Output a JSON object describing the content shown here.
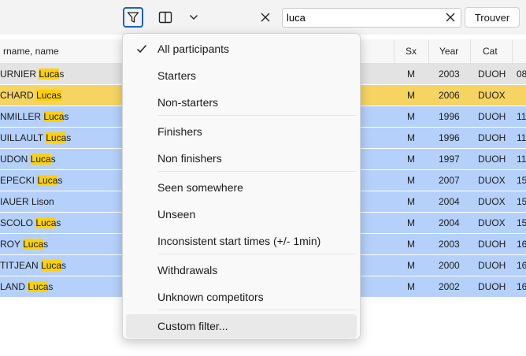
{
  "toolbar": {
    "search_value": "luca",
    "find_label": "Trouver"
  },
  "grid": {
    "columns": {
      "name": "rname, name",
      "sx": "Sx",
      "year": "Year",
      "cat": "Cat"
    },
    "rows": [
      {
        "pre": "URNIER ",
        "hl": "Luca",
        "post": "s",
        "sx": "M",
        "year": "2003",
        "cat": "DUOH",
        "extra": "08",
        "bg": "#e3e3e3"
      },
      {
        "pre": "CHARD ",
        "hl": "Lucas",
        "post": "",
        "sx": "M",
        "year": "2006",
        "cat": "DUOX",
        "extra": "",
        "bg": "#f6d462"
      },
      {
        "pre": "NMILLER ",
        "hl": "Luca",
        "post": "s",
        "sx": "M",
        "year": "1996",
        "cat": "DUOH",
        "extra": "11",
        "bg": "#b5d1fb"
      },
      {
        "pre": "UILLAULT ",
        "hl": "Luca",
        "post": "s",
        "sx": "M",
        "year": "1996",
        "cat": "DUOH",
        "extra": "11",
        "bg": "#b5d1fb"
      },
      {
        "pre": "UDON ",
        "hl": "Luca",
        "post": "s",
        "sx": "M",
        "year": "1997",
        "cat": "DUOH",
        "extra": "11",
        "bg": "#b5d1fb"
      },
      {
        "pre": "EPECKI ",
        "hl": "Luca",
        "post": "s",
        "sx": "M",
        "year": "2007",
        "cat": "DUOX",
        "extra": "15",
        "bg": "#b5d1fb"
      },
      {
        "pre": "IAUER Lison",
        "hl": "",
        "post": "",
        "sx": "M",
        "year": "2004",
        "cat": "DUOX",
        "extra": "15",
        "bg": "#b5d1fb"
      },
      {
        "pre": "SCOLO ",
        "hl": "Luca",
        "post": "s",
        "sx": "M",
        "year": "2004",
        "cat": "DUOX",
        "extra": "15",
        "bg": "#b5d1fb"
      },
      {
        "pre": "ROY ",
        "hl": "Luca",
        "post": "s",
        "sx": "M",
        "year": "2003",
        "cat": "DUOH",
        "extra": "16",
        "bg": "#b5d1fb"
      },
      {
        "pre": "TITJEAN ",
        "hl": "Luca",
        "post": "s",
        "sx": "M",
        "year": "2000",
        "cat": "DUOH",
        "extra": "16",
        "bg": "#b5d1fb"
      },
      {
        "pre": "LAND ",
        "hl": "Luca",
        "post": "s",
        "sx": "M",
        "year": "2002",
        "cat": "DUOH",
        "extra": "16",
        "bg": "#b5d1fb"
      }
    ]
  },
  "menu": {
    "items": [
      {
        "label": "All participants",
        "checked": true
      },
      {
        "label": "Starters"
      },
      {
        "label": "Non-starters"
      },
      {
        "label": "Finishers"
      },
      {
        "label": "Non finishers"
      },
      {
        "label": "Seen somewhere"
      },
      {
        "label": "Unseen"
      },
      {
        "label": "Inconsistent start times (+/- 1min)"
      },
      {
        "label": "Withdrawals"
      },
      {
        "label": "Unknown competitors"
      },
      {
        "label": "Custom filter...",
        "hover": true
      }
    ]
  }
}
